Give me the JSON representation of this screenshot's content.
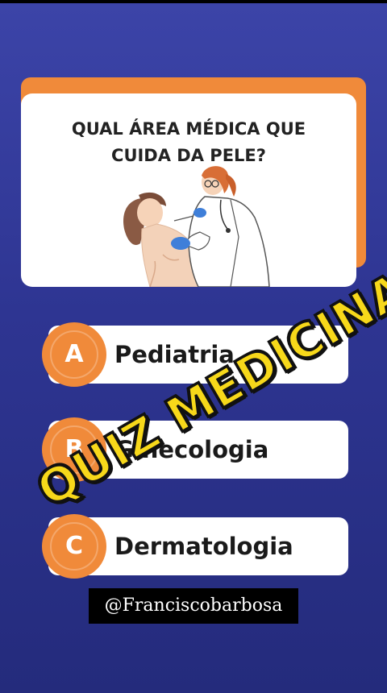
{
  "question": {
    "line1": "QUAL ÁREA MÉDICA QUE",
    "line2": "CUIDA DA PELE?",
    "illustration_icon": "doctor-examining-patient-illustration"
  },
  "answers": [
    {
      "letter": "A",
      "label": "Pediatria"
    },
    {
      "letter": "B",
      "label": "Ginecologia"
    },
    {
      "letter": "C",
      "label": "Dermatologia"
    }
  ],
  "overlay": {
    "text": "QUIZ MEDICINA"
  },
  "handle": {
    "text": "@Franciscobarbosa"
  },
  "colors": {
    "accent": "#f08a3a",
    "background": "#2e3592",
    "overlay_text": "#f7d81a",
    "card": "#ffffff"
  }
}
